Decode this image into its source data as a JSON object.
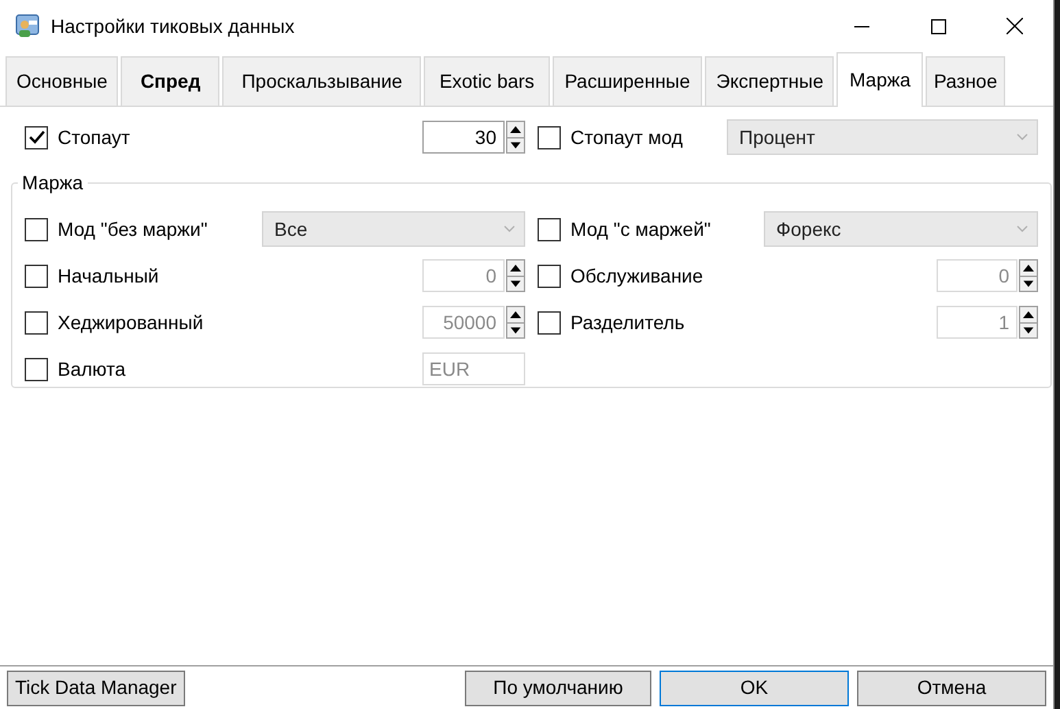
{
  "window": {
    "title": "Настройки тиковых данных"
  },
  "tabs": [
    {
      "label": "Основные",
      "selected": false,
      "bold": false
    },
    {
      "label": "Спред",
      "selected": false,
      "bold": true
    },
    {
      "label": "Проскальзывание",
      "selected": false,
      "bold": false
    },
    {
      "label": "Exotic bars",
      "selected": false,
      "bold": false
    },
    {
      "label": "Расширенные",
      "selected": false,
      "bold": false
    },
    {
      "label": "Экспертные",
      "selected": false,
      "bold": false
    },
    {
      "label": "Маржа",
      "selected": true,
      "bold": false
    },
    {
      "label": "Разное",
      "selected": false,
      "bold": false
    }
  ],
  "top_row": [
    {
      "kind": "spinner",
      "label": "Стопаут",
      "checked": true,
      "value": "30",
      "disabled": false
    },
    {
      "kind": "combo",
      "label": "Стопаут мод",
      "checked": false,
      "value": "Процент",
      "disabled": true
    }
  ],
  "margin_group": {
    "title": "Маржа",
    "left": [
      {
        "kind": "combo",
        "label": "Мод \"без маржи\"",
        "checked": false,
        "value": "Все",
        "disabled": true
      },
      {
        "kind": "spinner",
        "label": "Начальный",
        "checked": false,
        "value": "0",
        "disabled": true
      },
      {
        "kind": "spinner",
        "label": "Хеджированный",
        "checked": false,
        "value": "50000",
        "disabled": true
      },
      {
        "kind": "text",
        "label": "Валюта",
        "checked": false,
        "value": "EUR",
        "disabled": true
      }
    ],
    "right": [
      {
        "kind": "combo",
        "label": "Мод \"с маржей\"",
        "checked": false,
        "value": "Форекс",
        "disabled": true
      },
      {
        "kind": "spinner",
        "label": "Обслуживание",
        "checked": false,
        "value": "0",
        "disabled": true
      },
      {
        "kind": "spinner",
        "label": "Разделитель",
        "checked": false,
        "value": "1",
        "disabled": true
      }
    ]
  },
  "buttons": {
    "left": [
      {
        "label": "Tick Data Manager",
        "default": false
      }
    ],
    "right": [
      {
        "label": "По умолчанию",
        "default": false
      },
      {
        "label": "OK",
        "default": true
      },
      {
        "label": "Отмена",
        "default": false
      }
    ]
  }
}
